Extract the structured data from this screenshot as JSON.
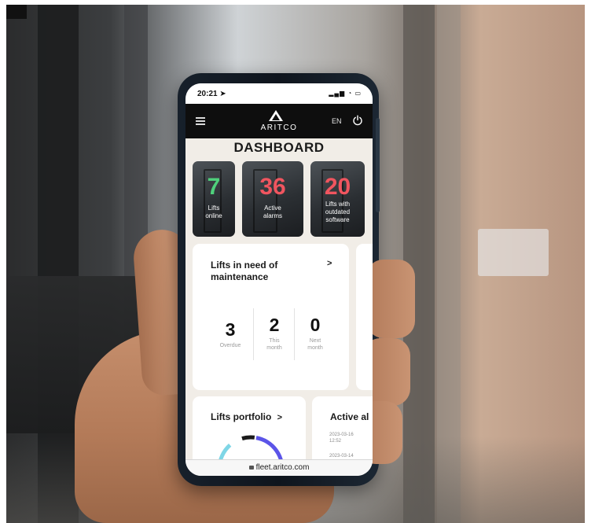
{
  "status": {
    "time": "20:21 ➤",
    "icons": "▂▄▆ ◔ ▭"
  },
  "header": {
    "brand": "ARITCO",
    "language": "EN"
  },
  "dashboard": {
    "title": "DASHBOARD",
    "stats": [
      {
        "value": "7",
        "label": "Lifts\nonline",
        "color": "#4fd17c"
      },
      {
        "value": "36",
        "label": "Active\nalarms",
        "color": "#f0555f"
      },
      {
        "value": "20",
        "label": "Lifts with\noutdated\nsoftware",
        "color": "#f0555f"
      }
    ],
    "maintenance": {
      "title": "Lifts in need of maintenance",
      "chevron": ">",
      "metrics": [
        {
          "value": "3",
          "label": "Overdue"
        },
        {
          "value": "2",
          "label": "This\nmonth"
        },
        {
          "value": "0",
          "label": "Next\nmonth"
        }
      ]
    },
    "portfolio": {
      "title": "Lifts portfolio",
      "chevron": ">",
      "colors": [
        "#5b54e8",
        "#7fd6e6",
        "#1a1a1a"
      ]
    },
    "alarms": {
      "title": "Active al",
      "rows": [
        {
          "date": "2023-03-16",
          "time": "12:52"
        },
        {
          "date": "2023-03-14",
          "time": ""
        }
      ]
    }
  },
  "browser": {
    "url": "fleet.aritco.com"
  }
}
